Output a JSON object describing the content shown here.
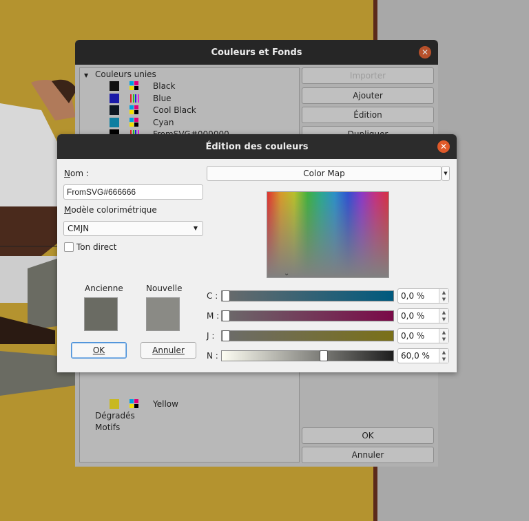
{
  "background_window": {
    "title": "Couleurs et Fonds",
    "tree": {
      "root_label": "Couleurs unies",
      "colors": [
        {
          "name": "Black",
          "swatch": "#111111",
          "model": "cmyk"
        },
        {
          "name": "Blue",
          "swatch": "#1a1aa8",
          "model": "rgb"
        },
        {
          "name": "Cool Black",
          "swatch": "#0d1620",
          "model": "cmyk"
        },
        {
          "name": "Cyan",
          "swatch": "#0d7ea0",
          "model": "cmyk"
        },
        {
          "name": "FromSVG#000000",
          "swatch": "#000000",
          "model": "rgb"
        }
      ],
      "last_color": {
        "name": "Yellow",
        "swatch": "#c8b820",
        "model": "cmyk"
      },
      "gradients_label": "Dégradés",
      "patterns_label": "Motifs"
    },
    "buttons": {
      "import": "Importer",
      "add": "Ajouter",
      "edit": "Édition",
      "duplicate": "Dupliquer",
      "ok": "OK",
      "cancel": "Annuler"
    }
  },
  "dialog": {
    "title": "Édition des couleurs",
    "name_label": "Nom :",
    "name_value": "FromSVG#666666",
    "model_label": "Modèle colorimétrique",
    "model_value": "CMJN",
    "spot_label": "Ton direct",
    "spot_checked": false,
    "old_label": "Ancienne",
    "new_label": "Nouvelle",
    "old_color": "#6a6b63",
    "new_color": "#8a8a85",
    "ok_label": "OK",
    "cancel_label": "Annuler",
    "view_mode": "Color Map",
    "channels": [
      {
        "key": "C",
        "label": "C :",
        "value": "0,0 %",
        "level": 0.0,
        "from": "#6b6b6b",
        "to": "#005a7e"
      },
      {
        "key": "M",
        "label": "M :",
        "value": "0,0 %",
        "level": 0.0,
        "from": "#6b6b6b",
        "to": "#7a0a48"
      },
      {
        "key": "J",
        "label": "J :",
        "value": "0,0 %",
        "level": 0.0,
        "from": "#6b6b6b",
        "to": "#7a7018"
      },
      {
        "key": "N",
        "label": "N :",
        "value": "60,0 %",
        "level": 0.6,
        "from": "#fdfdf2",
        "to": "#1e1e1e"
      }
    ]
  }
}
